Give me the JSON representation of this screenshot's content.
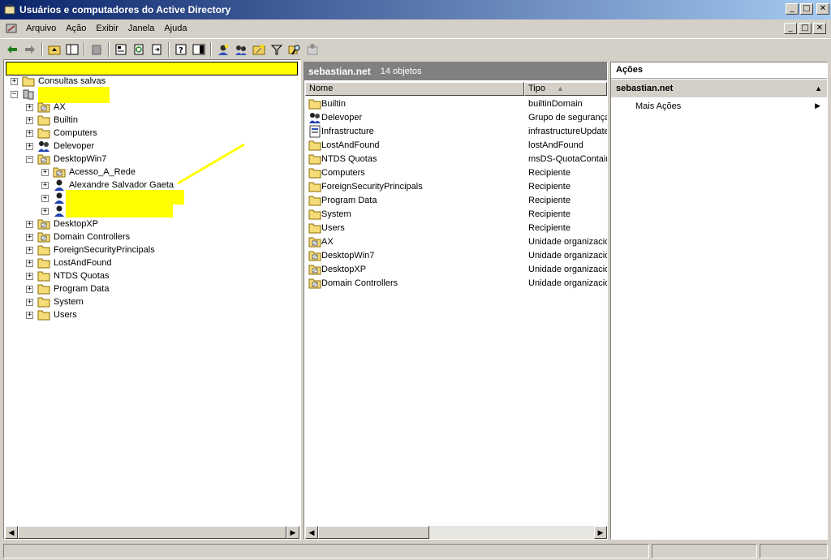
{
  "window": {
    "title": "Usuários e computadores do Active Directory",
    "buttons": {
      "minimize": "_",
      "maximize": "□",
      "close": "✕"
    }
  },
  "menu": [
    {
      "label": "Arquivo"
    },
    {
      "label": "Ação"
    },
    {
      "label": "Exibir"
    },
    {
      "label": "Janela"
    },
    {
      "label": "Ajuda"
    }
  ],
  "toolbar": {
    "icons": [
      "back-icon",
      "forward-icon",
      "up-folder-icon",
      "show-hide-tree-icon",
      "delete-icon",
      "properties-icon",
      "refresh-icon",
      "export-list-icon",
      "help-icon",
      "show-hide-action-pane-icon",
      "new-user-icon",
      "new-group-icon",
      "new-ou-icon",
      "filter-icon",
      "find-icon",
      "add-to-group-icon"
    ]
  },
  "tree": {
    "header_redacted": true,
    "items": [
      {
        "label": "Consultas salvas",
        "icon": "folder-icon",
        "indent": 0,
        "expander": "+"
      },
      {
        "label": "",
        "icon": "domain-icon",
        "indent": 0,
        "expander": "−",
        "redacted": true
      },
      {
        "label": "AX",
        "icon": "ou-icon",
        "indent": 1,
        "expander": "+"
      },
      {
        "label": "Builtin",
        "icon": "folder-icon",
        "indent": 1,
        "expander": "+"
      },
      {
        "label": "Computers",
        "icon": "folder-icon",
        "indent": 1,
        "expander": "+"
      },
      {
        "label": "Delevoper",
        "icon": "group-icon",
        "indent": 1,
        "expander": "+"
      },
      {
        "label": "DesktopWin7",
        "icon": "ou-icon",
        "indent": 1,
        "expander": "−"
      },
      {
        "label": "Acesso_A_Rede",
        "icon": "ou-icon",
        "indent": 2,
        "expander": "+"
      },
      {
        "label": "Alexandre Salvador Gaeta",
        "icon": "user-icon",
        "indent": 2,
        "expander": "+"
      },
      {
        "label": "",
        "icon": "user-icon",
        "indent": 2,
        "expander": "+",
        "redacted": true
      },
      {
        "label": "",
        "icon": "user-icon",
        "indent": 2,
        "expander": "+",
        "redacted": true
      },
      {
        "label": "DesktopXP",
        "icon": "ou-icon",
        "indent": 1,
        "expander": "+"
      },
      {
        "label": "Domain Controllers",
        "icon": "ou-icon",
        "indent": 1,
        "expander": "+"
      },
      {
        "label": "ForeignSecurityPrincipals",
        "icon": "folder-icon",
        "indent": 1,
        "expander": "+"
      },
      {
        "label": "LostAndFound",
        "icon": "folder-icon",
        "indent": 1,
        "expander": "+"
      },
      {
        "label": "NTDS Quotas",
        "icon": "folder-icon",
        "indent": 1,
        "expander": "+"
      },
      {
        "label": "Program Data",
        "icon": "folder-icon",
        "indent": 1,
        "expander": "+"
      },
      {
        "label": "System",
        "icon": "folder-icon",
        "indent": 1,
        "expander": "+"
      },
      {
        "label": "Users",
        "icon": "folder-icon",
        "indent": 1,
        "expander": "+"
      }
    ]
  },
  "list": {
    "title": "sebastian.net",
    "count": "14 objetos",
    "columns": {
      "name": "Nome",
      "type": "Tipo"
    },
    "rows": [
      {
        "name": "Builtin",
        "type": "builtinDomain",
        "icon": "folder-icon"
      },
      {
        "name": "Delevoper",
        "type": "Grupo de segurança",
        "icon": "group-icon"
      },
      {
        "name": "Infrastructure",
        "type": "infrastructureUpdate",
        "icon": "infrastructure-icon"
      },
      {
        "name": "LostAndFound",
        "type": "lostAndFound",
        "icon": "folder-icon"
      },
      {
        "name": "NTDS Quotas",
        "type": "msDS-QuotaContainer",
        "icon": "folder-icon"
      },
      {
        "name": "Computers",
        "type": "Recipiente",
        "icon": "folder-icon"
      },
      {
        "name": "ForeignSecurityPrincipals",
        "type": "Recipiente",
        "icon": "folder-icon"
      },
      {
        "name": "Program Data",
        "type": "Recipiente",
        "icon": "folder-icon"
      },
      {
        "name": "System",
        "type": "Recipiente",
        "icon": "folder-icon"
      },
      {
        "name": "Users",
        "type": "Recipiente",
        "icon": "folder-icon"
      },
      {
        "name": "AX",
        "type": "Unidade organizacional",
        "icon": "ou-icon"
      },
      {
        "name": "DesktopWin7",
        "type": "Unidade organizacional",
        "icon": "ou-icon"
      },
      {
        "name": "DesktopXP",
        "type": "Unidade organizacional",
        "icon": "ou-icon"
      },
      {
        "name": "Domain Controllers",
        "type": "Unidade organizacional",
        "icon": "ou-icon"
      }
    ]
  },
  "actions": {
    "title": "Ações",
    "section": "sebastian.net",
    "items": [
      {
        "label": "Mais Ações"
      }
    ]
  }
}
